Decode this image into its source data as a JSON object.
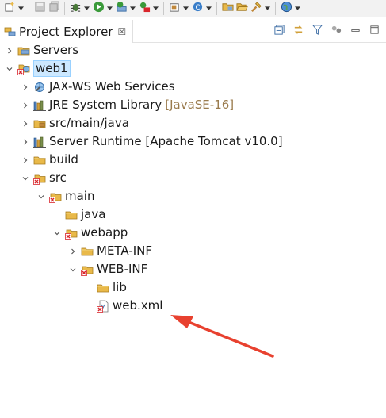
{
  "toolbar": {
    "buttons": [
      {
        "name": "new-wizard-icon",
        "dropdown": true
      },
      {
        "name": "save-icon",
        "dropdown": false
      },
      {
        "name": "save-all-icon",
        "dropdown": false
      },
      {
        "name": "debug-icon",
        "dropdown": true
      },
      {
        "name": "run-icon",
        "dropdown": true
      },
      {
        "name": "run-server-icon",
        "dropdown": true
      },
      {
        "name": "external-tools-icon",
        "dropdown": true
      },
      {
        "name": "new-java-package-icon",
        "dropdown": true
      },
      {
        "name": "new-java-class-icon",
        "dropdown": true
      },
      {
        "name": "open-type-icon",
        "dropdown": false
      },
      {
        "name": "open-folder-icon",
        "dropdown": false
      },
      {
        "name": "search-icon",
        "dropdown": true
      },
      {
        "name": "globe-icon",
        "dropdown": true
      }
    ]
  },
  "view": {
    "title": "Project Explorer",
    "close_glyph": "☒",
    "tools": [
      "collapse-all-icon",
      "link-with-editor-icon",
      "filter-icon",
      "focus-icon",
      "minimize-icon",
      "maximize-icon"
    ]
  },
  "tree": [
    {
      "label": "Servers",
      "depth": 0,
      "state": "collapsed",
      "icon": "folder-servers-icon"
    },
    {
      "label": "web1",
      "depth": 0,
      "state": "expanded",
      "icon": "web-project-icon",
      "selected": true
    },
    {
      "label": "JAX-WS Web Services",
      "depth": 1,
      "state": "collapsed",
      "icon": "web-services-icon"
    },
    {
      "label": "JRE System Library",
      "decoration": "[JavaSE-16]",
      "depth": 1,
      "state": "collapsed",
      "icon": "library-icon"
    },
    {
      "label": "src/main/java",
      "depth": 1,
      "state": "collapsed",
      "icon": "source-folder-icon"
    },
    {
      "label": "Server Runtime [Apache Tomcat v10.0]",
      "depth": 1,
      "state": "collapsed",
      "icon": "library-icon"
    },
    {
      "label": "build",
      "depth": 1,
      "state": "collapsed",
      "icon": "folder-icon"
    },
    {
      "label": "src",
      "depth": 1,
      "state": "expanded",
      "icon": "folder-error-icon"
    },
    {
      "label": "main",
      "depth": 2,
      "state": "expanded",
      "icon": "folder-error-icon"
    },
    {
      "label": "java",
      "depth": 3,
      "state": "none",
      "icon": "folder-icon"
    },
    {
      "label": "webapp",
      "depth": 3,
      "state": "expanded",
      "icon": "folder-error-icon"
    },
    {
      "label": "META-INF",
      "depth": 4,
      "state": "collapsed",
      "icon": "folder-icon"
    },
    {
      "label": "WEB-INF",
      "depth": 4,
      "state": "expanded",
      "icon": "folder-error-icon"
    },
    {
      "label": "lib",
      "depth": 5,
      "state": "none",
      "icon": "folder-icon"
    },
    {
      "label": "web.xml",
      "depth": 5,
      "state": "none",
      "icon": "xml-file-error-icon"
    }
  ],
  "colors": {
    "selection": "#cce8ff",
    "decoration": "#9a7b4d",
    "folder": "#e9b949",
    "error_marker": "#d9262c",
    "arrow": "#e8412f"
  }
}
